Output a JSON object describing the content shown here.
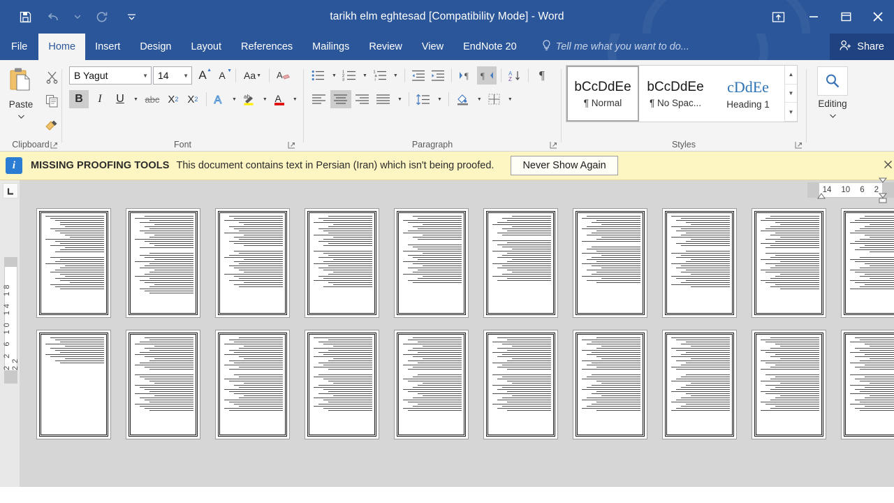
{
  "window": {
    "title": "tarikh elm eghtesad [Compatibility Mode] - Word",
    "accent_color": "#2b579a",
    "quick_access": [
      {
        "name": "save-icon",
        "label": "Save"
      },
      {
        "name": "undo-icon",
        "label": "Undo"
      },
      {
        "name": "undo-dropdown-icon",
        "label": "Undo options"
      },
      {
        "name": "redo-icon",
        "label": "Redo"
      },
      {
        "name": "customize-qat-icon",
        "label": "Customize Quick Access Toolbar"
      }
    ],
    "controls": [
      {
        "name": "ribbon-display-options-icon",
        "label": "Ribbon Display Options"
      },
      {
        "name": "minimize-icon",
        "label": "Minimize"
      },
      {
        "name": "restore-icon",
        "label": "Restore Down"
      },
      {
        "name": "close-icon",
        "label": "Close"
      }
    ]
  },
  "tabs": [
    {
      "label": "File",
      "active": false
    },
    {
      "label": "Home",
      "active": true
    },
    {
      "label": "Insert",
      "active": false
    },
    {
      "label": "Design",
      "active": false
    },
    {
      "label": "Layout",
      "active": false
    },
    {
      "label": "References",
      "active": false
    },
    {
      "label": "Mailings",
      "active": false
    },
    {
      "label": "Review",
      "active": false
    },
    {
      "label": "View",
      "active": false
    },
    {
      "label": "EndNote 20",
      "active": false
    }
  ],
  "tell_me": {
    "placeholder": "Tell me what you want to do...",
    "icon": "lightbulb-icon"
  },
  "share": {
    "label": "Share",
    "icon": "share-person-icon"
  },
  "ribbon": {
    "clipboard": {
      "label": "Clipboard",
      "paste_label": "Paste",
      "buttons": [
        "cut-icon",
        "copy-icon",
        "format-painter-icon"
      ]
    },
    "font": {
      "label": "Font",
      "font_name": "B Yagut",
      "font_size": "14",
      "grow_label": "A",
      "shrink_label": "A",
      "change_case_label": "Aa",
      "clear_format_label": "A",
      "bold_label": "B",
      "italic_label": "I",
      "underline_label": "U",
      "strike_label": "abc",
      "subscript_label": "X",
      "subscript_sup": "2",
      "superscript_label": "X",
      "superscript_sup": "2",
      "effects_label": "A",
      "highlight_label": "ab",
      "highlight_color": "#ffee00",
      "fontcolor_label": "A",
      "fontcolor": "#e00000",
      "bold_active": true
    },
    "paragraph": {
      "label": "Paragraph",
      "row1": [
        "bullets-icon",
        "numbering-icon",
        "multilevel-list-icon",
        "decrease-indent-icon",
        "increase-indent-icon",
        "ltr-text-direction-icon",
        "rtl-text-direction-icon",
        "sort-icon",
        "show-formatting-marks-icon"
      ],
      "row2": [
        "align-left-icon",
        "align-center-icon",
        "align-right-icon",
        "justify-icon",
        "line-spacing-icon",
        "shading-icon",
        "borders-icon"
      ],
      "active": [
        "rtl-text-direction-icon",
        "align-center-icon"
      ]
    },
    "styles": {
      "label": "Styles",
      "items": [
        {
          "preview": "bCcDdEe",
          "name": "Normal",
          "mark": "¶",
          "selected": true,
          "heading": false
        },
        {
          "preview": "bCcDdEe",
          "name": "No Spac...",
          "mark": "¶",
          "selected": false,
          "heading": false
        },
        {
          "preview": "cDdEe",
          "name": "Heading 1",
          "mark": "",
          "selected": false,
          "heading": true
        }
      ]
    },
    "editing": {
      "label": "Editing",
      "icon": "find-magnifier-icon"
    }
  },
  "infobar": {
    "icon": "info-icon",
    "title": "MISSING PROOFING TOOLS",
    "message": "This document contains text in Persian (Iran) which isn't being proofed.",
    "button": "Never Show Again",
    "close_icon": "close-icon",
    "background": "#fdf6c3"
  },
  "rulers": {
    "tab_selector_icon": "left-tab-stop-icon",
    "horizontal_ticks": [
      "14",
      "10",
      "6",
      "2"
    ],
    "vertical_ticks": "2  2  6  10  14  18  22"
  },
  "document": {
    "zoom_view": "multiple-pages",
    "rows": [
      {
        "pages": [
          {
            "columns": [
              [
                12,
                11,
                10,
                9,
                9,
                8,
                11,
                10,
                9,
                8,
                7,
                12,
                10,
                9,
                11,
                8,
                9,
                10
              ],
              [
                11,
                9,
                10,
                12,
                8,
                9,
                10,
                11,
                9,
                8,
                10,
                9,
                7,
                11,
                10,
                9
              ]
            ]
          },
          {
            "columns": [
              [
                10,
                12,
                9,
                11,
                8,
                10,
                9,
                11,
                10,
                8,
                9,
                12,
                10,
                9,
                8,
                11
              ],
              [
                9,
                11,
                10,
                8,
                12,
                9,
                10,
                11,
                8,
                9,
                10,
                12,
                9,
                11,
                10,
                8,
                9,
                11,
                10,
                9
              ]
            ]
          },
          {
            "columns": [
              [
                11,
                10,
                12,
                9,
                8,
                11,
                10,
                9,
                12,
                8,
                10,
                9,
                11,
                10,
                8
              ],
              [
                10,
                9,
                11,
                12,
                8,
                10,
                9,
                11,
                10,
                9,
                8,
                12,
                10,
                9,
                11,
                8,
                10,
                9
              ]
            ]
          },
          {
            "columns": [
              [
                9,
                11,
                10,
                12,
                8,
                9,
                11,
                10,
                9,
                12,
                8,
                10,
                11,
                9,
                10
              ],
              [
                12,
                10,
                9,
                11,
                8,
                10,
                12,
                9,
                11,
                10,
                8,
                9,
                11,
                10,
                12,
                9,
                8,
                10
              ]
            ]
          },
          {
            "columns": [
              [
                10,
                9,
                12,
                11,
                8,
                10,
                9,
                11,
                12,
                8,
                10,
                9
              ],
              [
                11,
                10,
                9,
                12,
                8,
                11,
                10,
                9,
                12,
                10,
                8,
                11,
                9,
                10,
                12,
                8,
                9,
                11,
                10
              ]
            ]
          },
          {
            "columns": [
              [
                8,
                10,
                9,
                11,
                12,
                8,
                10,
                9,
                11,
                10
              ],
              [
                12,
                9,
                11,
                10,
                8,
                12,
                9,
                10,
                11,
                8,
                9,
                12,
                10,
                11,
                9,
                8,
                10,
                12,
                9,
                11
              ]
            ]
          },
          {
            "columns": [
              [
                11,
                12,
                9,
                10,
                8,
                11,
                12,
                9,
                10,
                11,
                8,
                9,
                12
              ],
              [
                10,
                11,
                9,
                12,
                8,
                10,
                11,
                9,
                12,
                10,
                8,
                11,
                9,
                10,
                12,
                8,
                11,
                9
              ]
            ]
          },
          {
            "columns": [
              [
                12,
                10,
                11,
                9,
                8,
                12,
                10,
                11,
                9,
                10,
                12,
                8,
                9,
                11,
                10
              ],
              [
                9,
                12,
                10,
                11,
                8,
                9,
                12,
                10,
                11,
                9,
                10,
                8,
                12,
                11,
                9,
                10,
                12,
                8
              ]
            ]
          },
          {
            "columns": [
              [
                10,
                11,
                12,
                9,
                8,
                10,
                11,
                12,
                9,
                10,
                8,
                11,
                9,
                12,
                10,
                11
              ],
              [
                11,
                9,
                10,
                12,
                8,
                11,
                9,
                10,
                12,
                11,
                8,
                9,
                10,
                12,
                11,
                9,
                10,
                8
              ]
            ]
          },
          {
            "columns": [
              [
                9,
                10,
                11,
                12,
                8,
                9,
                10,
                11,
                12,
                9,
                8,
                10,
                11,
                12,
                9,
                10,
                11,
                8
              ],
              [
                10,
                12,
                11,
                9,
                8,
                10,
                12,
                11,
                9,
                10,
                8,
                12,
                11,
                9,
                10,
                12
              ]
            ]
          }
        ]
      },
      {
        "pages": [
          {
            "columns": [
              [
                11,
                10,
                9,
                12,
                8,
                11,
                10,
                9,
                12,
                11,
                8,
                10,
                9
              ],
              [
                0
              ]
            ]
          },
          {
            "columns": [
              [
                10,
                9,
                11,
                12,
                8,
                10,
                9,
                11,
                12,
                10,
                8,
                9,
                11,
                12,
                10,
                9
              ],
              [
                12,
                11,
                10,
                9,
                8,
                12,
                11,
                10,
                9,
                12,
                8,
                11,
                10,
                9,
                12,
                11,
                10,
                9
              ]
            ]
          },
          {
            "columns": [
              [
                9,
                11,
                10,
                12,
                8,
                9,
                11,
                10,
                12,
                9,
                8,
                11,
                10,
                12,
                9,
                11
              ],
              [
                10,
                9,
                12,
                11,
                8,
                10,
                9,
                12,
                11,
                10,
                8,
                9,
                12,
                11,
                10,
                9,
                12,
                11
              ]
            ]
          },
          {
            "columns": [
              [
                12,
                9,
                11,
                10,
                8,
                12,
                9,
                11,
                10,
                12,
                8,
                9,
                11,
                10,
                12,
                9
              ],
              [
                11,
                12,
                10,
                9,
                8,
                11,
                12,
                10,
                9,
                11,
                8,
                12,
                10,
                9,
                11,
                12,
                10,
                9
              ]
            ]
          },
          {
            "columns": [
              [
                10,
                11,
                9,
                12,
                8,
                10,
                11,
                9,
                12,
                10,
                8,
                11,
                9,
                12,
                10,
                11
              ],
              [
                9,
                10,
                12,
                11,
                8,
                9,
                10,
                12,
                11,
                9,
                8,
                10,
                12,
                11,
                9,
                10,
                12,
                11
              ]
            ]
          },
          {
            "columns": [
              [
                11,
                9,
                12,
                10,
                8,
                11,
                9,
                12,
                10,
                11,
                8,
                9,
                12,
                10,
                11,
                9
              ],
              [
                12,
                10,
                11,
                9,
                8,
                12,
                10,
                11,
                9,
                12,
                8,
                10,
                11,
                9,
                12,
                10,
                11,
                9
              ]
            ]
          },
          {
            "columns": [
              [
                9,
                12,
                10,
                11,
                8,
                9,
                12,
                10,
                11,
                9,
                8,
                12,
                10,
                11,
                9,
                12
              ],
              [
                10,
                11,
                12,
                9,
                8,
                10,
                11,
                12,
                9,
                10,
                8,
                11,
                12,
                9,
                10,
                11,
                12,
                9
              ]
            ]
          },
          {
            "columns": [
              [
                12,
                11,
                9,
                10,
                8,
                12,
                11,
                9,
                10,
                12,
                8,
                11,
                9,
                10,
                12,
                11
              ],
              [
                9,
                10,
                11,
                12,
                8,
                9,
                10,
                11,
                12,
                9,
                8,
                10,
                11,
                12,
                9,
                10,
                11,
                12
              ]
            ]
          },
          {
            "columns": [
              [
                10,
                12,
                11,
                9,
                8,
                10,
                12,
                11,
                9,
                10,
                8,
                12,
                11,
                9,
                10,
                12
              ],
              [
                11,
                9,
                10,
                12,
                8,
                11,
                9,
                10,
                12,
                11,
                8,
                9,
                10,
                12,
                11,
                9,
                10,
                12
              ]
            ]
          },
          {
            "columns": [
              [
                11,
                10,
                12,
                9,
                8,
                11,
                10,
                12,
                9,
                11,
                8,
                10,
                12,
                9,
                11,
                10
              ],
              [
                12,
                9,
                11,
                10,
                8,
                12,
                9,
                11,
                10,
                12,
                8,
                9,
                11,
                10,
                12,
                9,
                11,
                10
              ]
            ]
          }
        ]
      }
    ]
  }
}
